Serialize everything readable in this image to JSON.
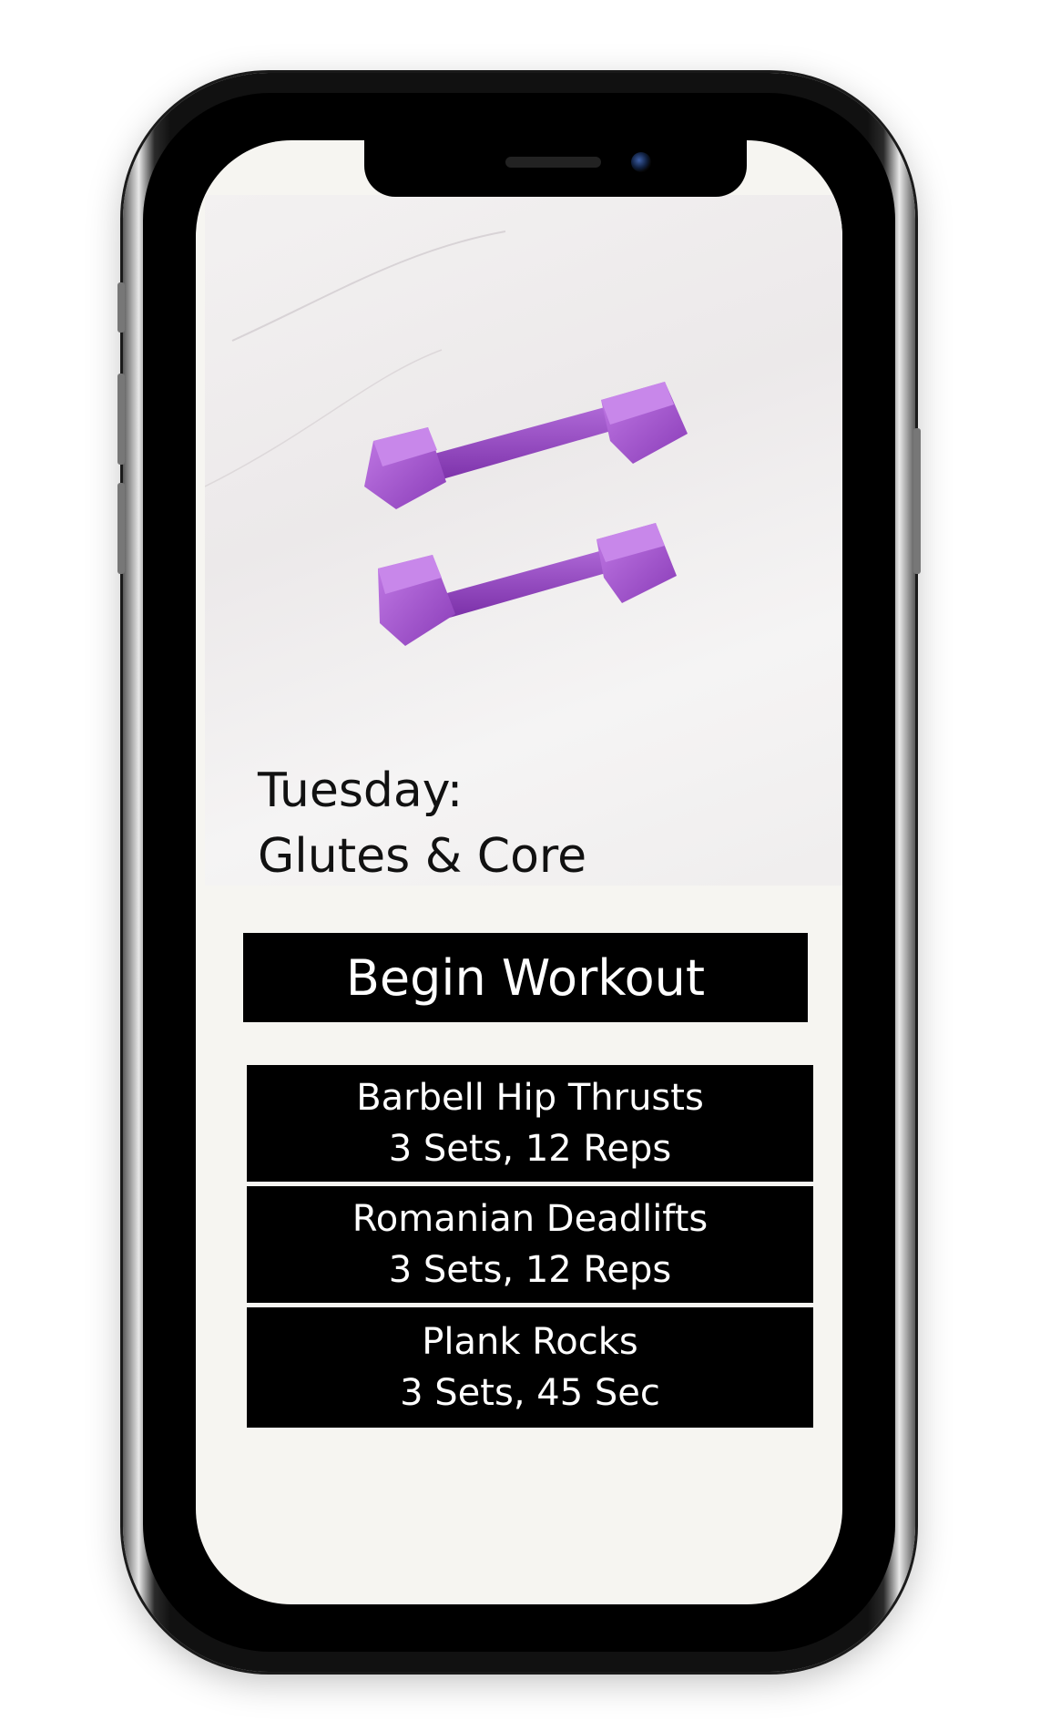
{
  "screen": {
    "day_label": "Tuesday:",
    "workout_title": "Glutes & Core",
    "begin_button_label": "Begin Workout",
    "exercises": [
      {
        "name": "Barbell Hip Thrusts",
        "detail": "3 Sets, 12 Reps"
      },
      {
        "name": "Romanian Deadlifts",
        "detail": "3 Sets, 12 Reps"
      },
      {
        "name": "Plank Rocks",
        "detail": "3 Sets, 45 Sec"
      }
    ]
  },
  "colors": {
    "dumbbell": "#9b4fc6",
    "button_bg": "#000000",
    "button_text": "#ffffff",
    "screen_bg": "#f6f5f1"
  }
}
